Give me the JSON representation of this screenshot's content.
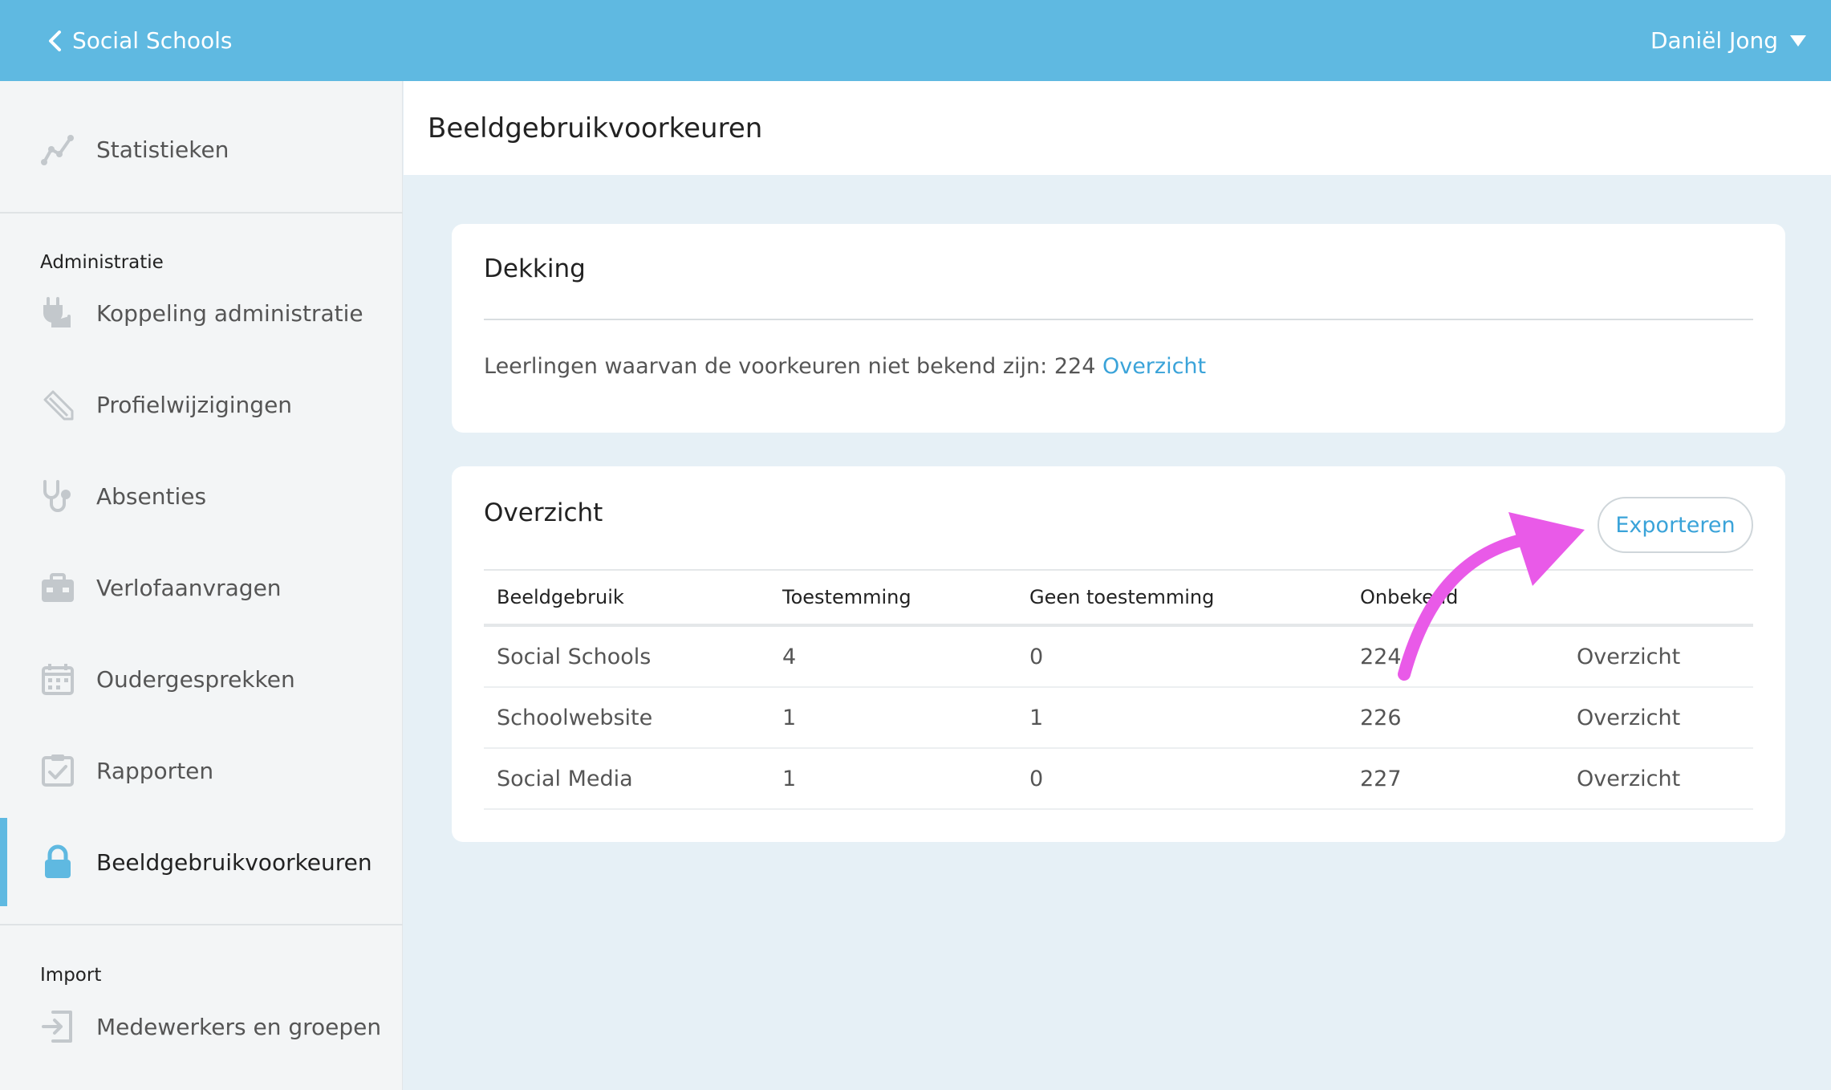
{
  "topbar": {
    "back_label": "Social Schools",
    "user_name": "Daniël Jong"
  },
  "sidebar": {
    "stats_label": "Statistieken",
    "admin_heading": "Administratie",
    "items": [
      {
        "label": "Koppeling administratie",
        "icon": "plug-icon"
      },
      {
        "label": "Profielwijzigingen",
        "icon": "pencil-icon"
      },
      {
        "label": "Absenties",
        "icon": "stethoscope-icon"
      },
      {
        "label": "Verlofaanvragen",
        "icon": "suitcase-icon"
      },
      {
        "label": "Oudergesprekken",
        "icon": "calendar-icon"
      },
      {
        "label": "Rapporten",
        "icon": "clipboard-check-icon"
      },
      {
        "label": "Beeldgebruikvoorkeuren",
        "icon": "lock-icon",
        "active": true
      }
    ],
    "import_heading": "Import",
    "import_items": [
      {
        "label": "Medewerkers en groepen",
        "icon": "import-icon"
      }
    ]
  },
  "page": {
    "title": "Beeldgebruikvoorkeuren"
  },
  "coverage": {
    "title": "Dekking",
    "text": "Leerlingen waarvan de voorkeuren niet bekend zijn: 224",
    "link": "Overzicht"
  },
  "overview": {
    "title": "Overzicht",
    "export_label": "Exporteren",
    "columns": [
      "Beeldgebruik",
      "Toestemming",
      "Geen toestemming",
      "Onbekend"
    ],
    "rows": [
      {
        "name": "Social Schools",
        "consent": "4",
        "no_consent": "0",
        "unknown": "224",
        "link": "Overzicht"
      },
      {
        "name": "Schoolwebsite",
        "consent": "1",
        "no_consent": "1",
        "unknown": "226",
        "link": "Overzicht"
      },
      {
        "name": "Social Media",
        "consent": "1",
        "no_consent": "0",
        "unknown": "227",
        "link": "Overzicht"
      }
    ]
  },
  "colors": {
    "topbar": "#5fb9e1",
    "link": "#3aa3d9",
    "annotation_arrow": "#e95ae8"
  }
}
